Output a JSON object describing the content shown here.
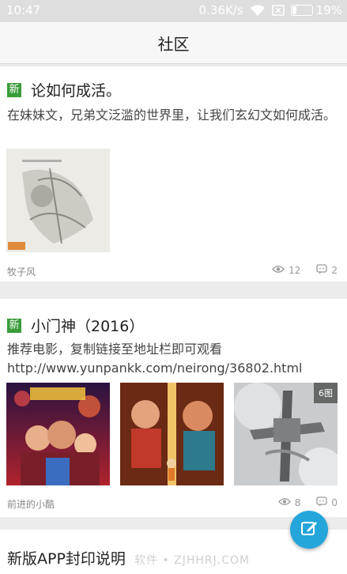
{
  "status_bar": {
    "time": "10:47",
    "speed": "0.36K/s",
    "battery": "19%",
    "battery_level": 0.19
  },
  "app_bar": {
    "title": "社区"
  },
  "posts": [
    {
      "tag": "新",
      "title": "论如何成活。",
      "body": "在妹妹文，兄弟文泛滥的世界里，让我们玄幻文如何成活。",
      "author": "牧子风",
      "views": "12",
      "comments": "2"
    },
    {
      "tag": "新",
      "title": "小门神（2016）",
      "body_line1": "推荐电影，复制链接至地址栏即可观看",
      "body_line2": "http://www.yunpankk.com/neirong/36802.html",
      "image_count": "6图",
      "author": "前进的小酷",
      "views": "8",
      "comments": "0"
    },
    {
      "title": "新版APP封印说明"
    }
  ],
  "watermark": "软件 • ZJHHRJ.COM",
  "icons": {
    "views": "eye-icon",
    "comments": "comment-icon",
    "fab": "edit-icon",
    "wifi": "wifi-icon",
    "sim": "sim-icon",
    "battery": "battery-icon"
  },
  "colors": {
    "accent": "#25a6da",
    "tag_green": "#3a9c3a"
  }
}
